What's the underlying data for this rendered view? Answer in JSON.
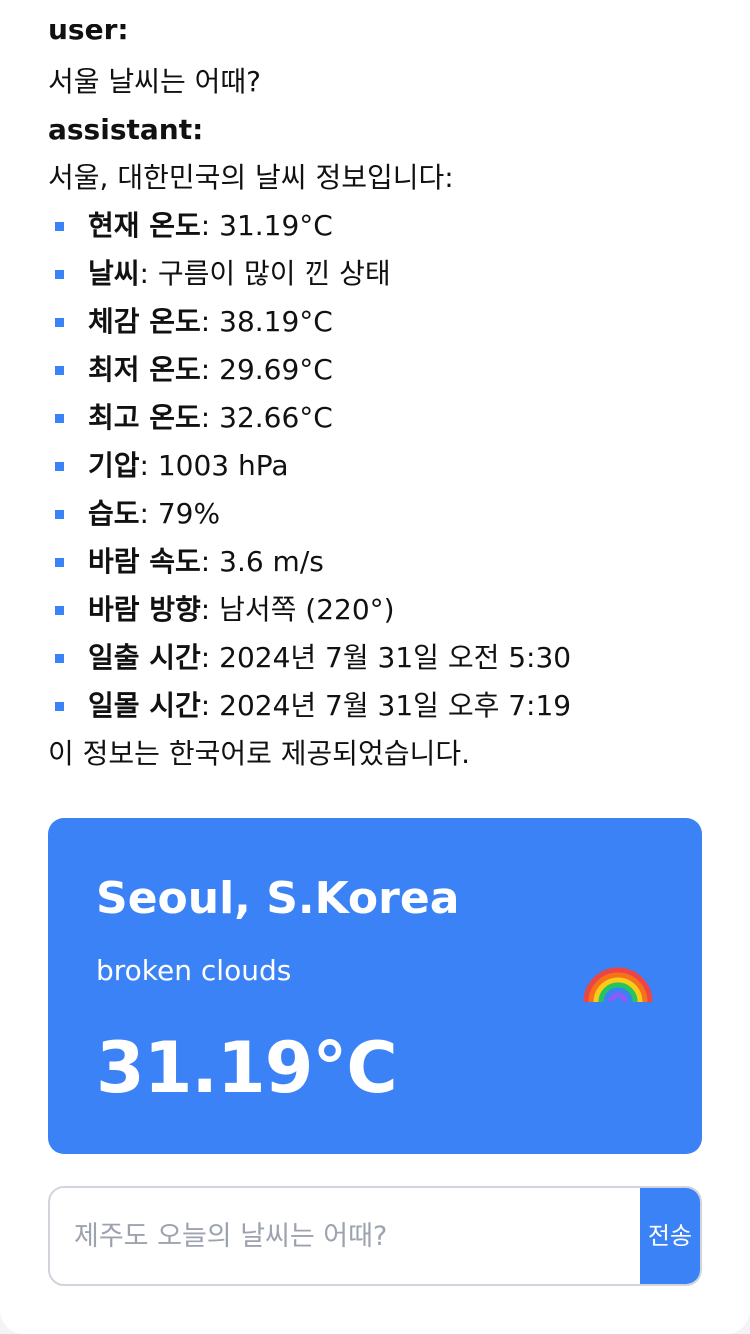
{
  "conversation": {
    "user_label": "user:",
    "user_message": "서울 날씨는 어때?",
    "assistant_label": "assistant:",
    "intro": "서울, 대한민국의 날씨 정보입니다:",
    "items": [
      {
        "key": "현재 온도",
        "value": ": 31.19°C"
      },
      {
        "key": "날씨",
        "value": ": 구름이 많이 낀 상태"
      },
      {
        "key": "체감 온도",
        "value": ": 38.19°C"
      },
      {
        "key": "최저 온도",
        "value": ": 29.69°C"
      },
      {
        "key": "최고 온도",
        "value": ": 32.66°C"
      },
      {
        "key": "기압",
        "value": ": 1003 hPa"
      },
      {
        "key": "습도",
        "value": ": 79%"
      },
      {
        "key": "바람 속도",
        "value": ": 3.6 m/s"
      },
      {
        "key": "바람 방향",
        "value": ": 남서쪽 (220°)"
      },
      {
        "key": "일출 시간",
        "value": ": 2024년 7월 31일 오전 5:30"
      },
      {
        "key": "일몰 시간",
        "value": ": 2024년 7월 31일 오후 7:19"
      }
    ],
    "outro": "이 정보는 한국어로 제공되었습니다."
  },
  "weather_card": {
    "city": "Seoul, S.Korea",
    "description": "broken clouds",
    "temperature": "31.19°C",
    "icon": "rainbow-icon",
    "background": "#3b82f6"
  },
  "composer": {
    "placeholder": "제주도 오늘의 날씨는 어때?",
    "value": "",
    "send_label": "전송"
  },
  "colors": {
    "accent": "#3b82f6",
    "text": "#111111",
    "placeholder": "#9ca3af"
  }
}
